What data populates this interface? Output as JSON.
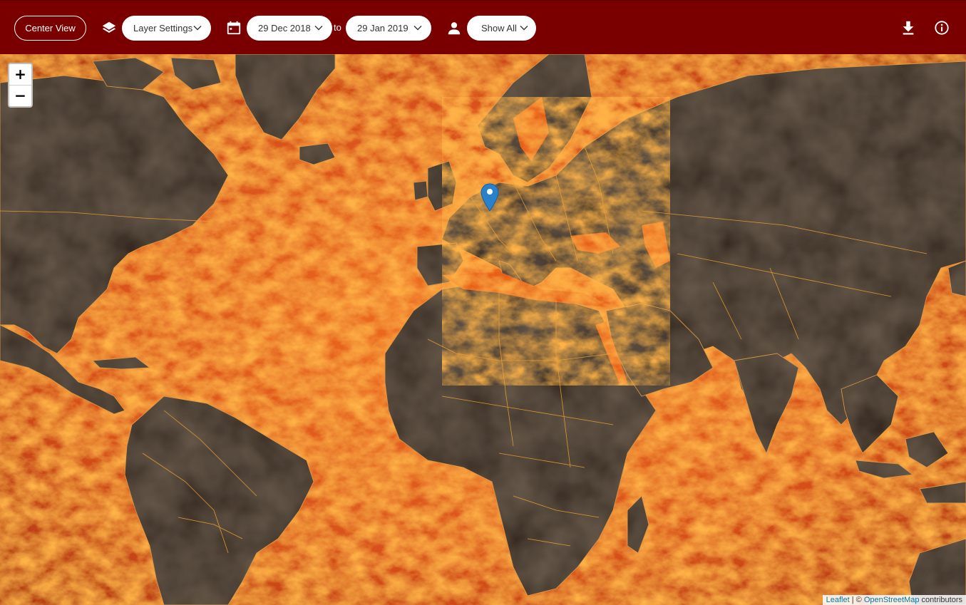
{
  "toolbar": {
    "center_view_label": "Center View",
    "layer_settings_label": "Layer Settings",
    "date_from": "29 Dec 2018",
    "to_label": "to",
    "date_to": "29 Jan 2019",
    "user_filter_label": "Show All",
    "icons": {
      "layers": "layers-icon",
      "calendar": "calendar-icon",
      "person": "person-icon",
      "download": "download-icon",
      "info": "info-icon"
    }
  },
  "map": {
    "zoom_in_label": "+",
    "zoom_out_label": "−",
    "marker": "map-marker-icon",
    "attribution": {
      "leaflet": "Leaflet",
      "separator": " | © ",
      "osm": "OpenStreetMap",
      "suffix": " contributors"
    }
  },
  "colors": {
    "toolbar_bg": "#7a0000",
    "ocean_heat": "#e8601a",
    "land": "#2e2118",
    "border_lines": "#f0a030",
    "marker": "#2a81cb"
  }
}
